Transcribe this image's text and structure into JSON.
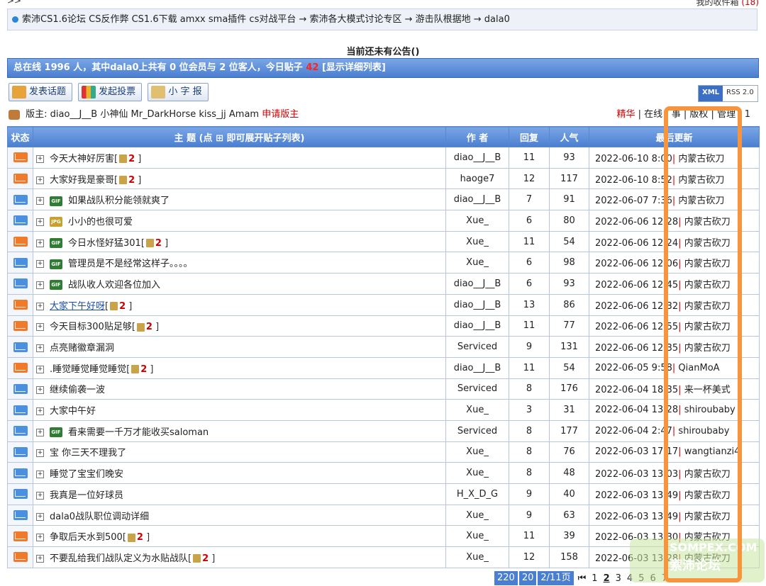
{
  "top": {
    "arrows": ">>",
    "fav_label": "我的收件箱",
    "fav_count": "(18)"
  },
  "breadcrumb": "索沛CS1.6论坛 CS反作弊 CS1.6下载 amxx sma插件 cs对战平台 → 索沛各大模式讨论专区 → 游击队根据地 → dala0",
  "notice": "当前还未有公告()",
  "online": {
    "prefix": "总在线 1996 人，其中dala0上共有 0 位会员与 2 位客人，今日贴子",
    "today": "42",
    "detail": "[显示详细列表]"
  },
  "actions": {
    "post": "发表话题",
    "vote": "发起投票",
    "news": "小 字 报"
  },
  "feeds": {
    "xml": "XML",
    "rss": "RSS 2.0"
  },
  "mods": {
    "label": "版主:",
    "list": "diao__J__B 小神仙 Mr_DarkHorse kiss_jj Amam",
    "apply": "申请版主",
    "right_essence": "精华",
    "right_rest": "| 在线 | 事 | 版权 | 管理 | 1"
  },
  "headers": {
    "status": "状态",
    "topic": "主 题 (点 ⊞ 即可展开贴子列表)",
    "author": "作 者",
    "reply": "回复",
    "views": "人气",
    "last": "最后更新"
  },
  "colors": {
    "header_blue": "#4a7ed0",
    "hot_mail": "#f07a2a",
    "normal_mail": "#4a8fe0",
    "highlight": "#f7943c"
  },
  "topics": [
    {
      "mail": "hot",
      "att": "",
      "title": "今天大神好厉害",
      "pages": "2",
      "author": "diao__J__B",
      "reply": "11",
      "views": "93",
      "date": "2022-06-10 8:",
      "time": "00",
      "user": "内蒙古砍刀"
    },
    {
      "mail": "hot",
      "att": "",
      "title": "大家好我是豪哥",
      "pages": "2",
      "author": "haoge7",
      "reply": "12",
      "views": "117",
      "date": "2022-06-10 8:",
      "time": "52",
      "user": "内蒙古砍刀"
    },
    {
      "mail": "norm",
      "att": "GIF",
      "title": "如果战队积分能领就爽了",
      "pages": "",
      "author": "diao__J__B",
      "reply": "7",
      "views": "91",
      "date": "2022-06-07 7:",
      "time": "36",
      "user": "内蒙古砍刀"
    },
    {
      "mail": "norm",
      "att": "JPG",
      "title": "小小的也很可爱",
      "pages": "",
      "author": "Xue_",
      "reply": "6",
      "views": "80",
      "date": "2022-06-06 12",
      "time": ":28",
      "user": "内蒙古砍刀"
    },
    {
      "mail": "hot",
      "att": "GIF",
      "title": "今日水怪好猛301",
      "pages": "2",
      "author": "Xue_",
      "reply": "11",
      "views": "54",
      "date": "2022-06-06 12",
      "time": ":24",
      "user": "内蒙古砍刀"
    },
    {
      "mail": "norm",
      "att": "GIF",
      "title": "管理员是不是经常这样子。。。。",
      "pages": "",
      "author": "Xue_",
      "reply": "6",
      "views": "98",
      "date": "2022-06-06 12",
      "time": ":06",
      "user": "内蒙古砍刀"
    },
    {
      "mail": "norm",
      "att": "GIF",
      "title": "战队收人欢迎各位加入",
      "pages": "",
      "author": "diao__J__B",
      "reply": "6",
      "views": "93",
      "date": "2022-06-06 12",
      "time": ":45",
      "user": "内蒙古砍刀"
    },
    {
      "mail": "hot",
      "att": "",
      "title": "大家下午好呀",
      "pages": "2",
      "author": "diao__J__B",
      "reply": "13",
      "views": "86",
      "date": "2022-06-06 12",
      "time": ":32",
      "user": "内蒙古砍刀",
      "link": true
    },
    {
      "mail": "hot",
      "att": "",
      "title": "今天目标300贴足够",
      "pages": "2",
      "author": "diao__J__B",
      "reply": "11",
      "views": "77",
      "date": "2022-06-06 12",
      "time": ":55",
      "user": "内蒙古砍刀"
    },
    {
      "mail": "norm",
      "att": "",
      "title": "点亮赌徽章漏洞",
      "pages": "",
      "author": "Serviced",
      "reply": "9",
      "views": "131",
      "date": "2022-06-06 12",
      "time": ":35",
      "user": "内蒙古砍刀"
    },
    {
      "mail": "hot",
      "att": "",
      "title": ".睡觉睡觉睡觉睡觉",
      "pages": "2",
      "author": "diao__J__B",
      "reply": "11",
      "views": "54",
      "date": "2022-06-05 9:",
      "time": "58",
      "user": "QianMoA"
    },
    {
      "mail": "norm",
      "att": "",
      "title": "继续偷袭一波",
      "pages": "",
      "author": "Serviced",
      "reply": "8",
      "views": "176",
      "date": "2022-06-04 18",
      "time": ":35",
      "user": "来一杯美式"
    },
    {
      "mail": "norm",
      "att": "",
      "title": "大家中午好",
      "pages": "",
      "author": "Xue_",
      "reply": "3",
      "views": "31",
      "date": "2022-06-04 13",
      "time": ":28",
      "user": "shiroubaby"
    },
    {
      "mail": "norm",
      "att": "GIF",
      "title": "看来需要一千万才能收买saloman",
      "pages": "",
      "author": "Serviced",
      "reply": "8",
      "views": "177",
      "date": "2022-06-04 2:",
      "time": "47",
      "user": "shiroubaby"
    },
    {
      "mail": "norm",
      "att": "",
      "title": "宝 你三天不理我了",
      "pages": "",
      "author": "Xue_",
      "reply": "8",
      "views": "76",
      "date": "2022-06-03 17",
      "time": ":17",
      "user": "wangtianzi4"
    },
    {
      "mail": "norm",
      "att": "",
      "title": "睡觉了宝宝们晚安",
      "pages": "",
      "author": "Xue_",
      "reply": "8",
      "views": "48",
      "date": "2022-06-03 13",
      "time": ":03",
      "user": "内蒙古砍刀"
    },
    {
      "mail": "norm",
      "att": "",
      "title": "我真是一位好球员",
      "pages": "",
      "author": "H_X_D_G",
      "reply": "9",
      "views": "40",
      "date": "2022-06-03 13",
      "time": ":49",
      "user": "内蒙古砍刀"
    },
    {
      "mail": "norm",
      "att": "",
      "title": "dala0战队职位调动详细",
      "pages": "",
      "author": "Xue_",
      "reply": "9",
      "views": "63",
      "date": "2022-06-03 13",
      "time": ":49",
      "user": "内蒙古砍刀"
    },
    {
      "mail": "hot",
      "att": "",
      "title": "争取后天水到500",
      "pages": "2",
      "author": "Xue_",
      "reply": "11",
      "views": "39",
      "date": "2022-06-03 13",
      "time": ":30",
      "user": "内蒙古砍刀"
    },
    {
      "mail": "hot",
      "att": "",
      "title": "不要乱给我们战队定义为水贴战队",
      "pages": "2",
      "author": "Xue_",
      "reply": "12",
      "views": "158",
      "date": "2022-06-03 13",
      "time": ":28",
      "user": "内蒙古砍刀"
    }
  ],
  "pager": {
    "total": "220",
    "per": "20",
    "pages": "2/11页",
    "first": "⏮",
    "nums": [
      "1",
      "2",
      "3",
      "4",
      "5",
      "6",
      "7"
    ],
    "current": "2"
  },
  "watermark": {
    "line1": "SOMPEX.COM",
    "line2": "索沛论坛"
  }
}
